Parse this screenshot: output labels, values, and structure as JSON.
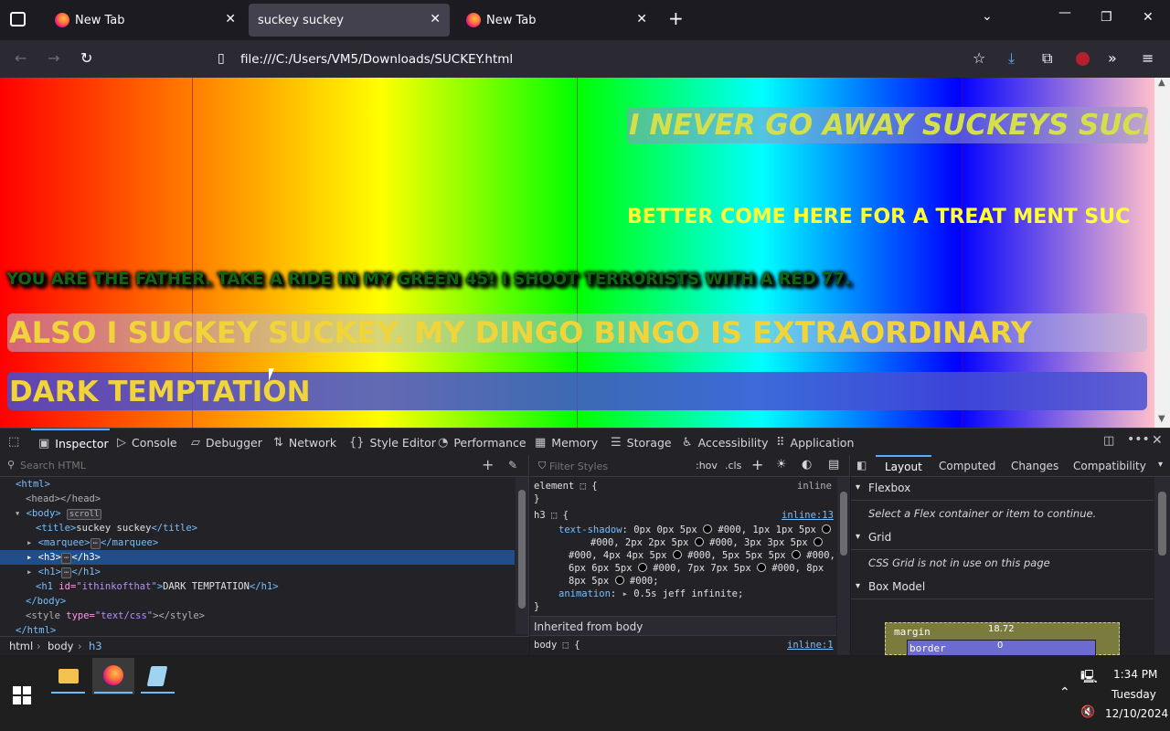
{
  "browser": {
    "tabs": [
      {
        "label": "New Tab"
      },
      {
        "label": "suckey suckey"
      },
      {
        "label": "New Tab"
      }
    ],
    "url": "file:///C:/Users/VM5/Downloads/SUCKEY.html"
  },
  "page": {
    "marquee1": "I NEVER GO AWAY SUCKEYS SUCK",
    "marquee2": "BETTER COME HERE FOR A TREAT MENT SUC",
    "h3": "YOU ARE THE FATHER. TAKE A RIDE IN MY GREEN 45! I SHOOT TERRORISTS WITH A RED 77.",
    "h1a": "ALSO I SUCKEY SUCKEY. MY DINGO BINGO IS EXTRAORDINARY",
    "h1b": "DARK TEMPTATION"
  },
  "devtools": {
    "tabs": [
      "Inspector",
      "Console",
      "Debugger",
      "Network",
      "Style Editor",
      "Performance",
      "Memory",
      "Storage",
      "Accessibility",
      "Application"
    ],
    "search_placeholder": "Search HTML",
    "filter_placeholder": "Filter Styles",
    "hov": ":hov",
    "cls": ".cls",
    "tree": {
      "html_open": "<html>",
      "head": "<head></head>",
      "body_open": "<body>",
      "scroll_badge": "scroll",
      "title_tag_open": "<title>",
      "title_text": "suckey suckey",
      "title_tag_close": "</title>",
      "marquee_open": "<marquee>",
      "marquee_close": "</marquee>",
      "h3_open": "<h3>",
      "h3_close": "</h3>",
      "h1_open": "<h1>",
      "h1_close": "</h1>",
      "h1_id_open": "<h1 ",
      "h1_attr": "id=",
      "h1_val": "\"ithinkofthat\"",
      "h1_text": "DARK TEMPTATION",
      "body_close": "</body>",
      "style_open": "<style ",
      "style_attr": "type=",
      "style_val": "\"text/css\"",
      "style_close": "></style>",
      "html_close": "</html>",
      "ellipsis": "⋯"
    },
    "breadcrumbs": [
      "html",
      "body",
      "h3"
    ],
    "rules": {
      "element_sel": "element",
      "element_src": "inline",
      "h3_sel": "h3",
      "h3_src": "inline:13",
      "text_shadow_prop": "text-shadow",
      "ts_lines": [
        "0px 0px 5px",
        "#000, 1px 1px 5px",
        "#000, 2px 2px 5px",
        "#000, 3px 3px 5px",
        "#000, 4px 4px 5px",
        "#000, 5px 5px 5px",
        "#000,",
        "6px 6px 5px",
        "#000, 7px 7px 5px",
        "#000, 8px",
        "8px 5px",
        "#000;"
      ],
      "animation_prop": "animation",
      "animation_val": "0.5s jeff infinite;",
      "inherited": "Inherited from body",
      "body_sel": "body",
      "body_src": "inline:1"
    },
    "layout_tabs": [
      "Layout",
      "Computed",
      "Changes",
      "Compatibility"
    ],
    "flexbox": "Flexbox",
    "flex_note": "Select a Flex container or item to continue.",
    "grid": "Grid",
    "grid_note": "CSS Grid is not in use on this page",
    "boxmodel": "Box Model",
    "margin_label": "margin",
    "margin_val": "18.72",
    "border_label": "border",
    "border_val": "0"
  },
  "taskbar": {
    "time": "1:34 PM",
    "day": "Tuesday",
    "date": "12/10/2024"
  }
}
